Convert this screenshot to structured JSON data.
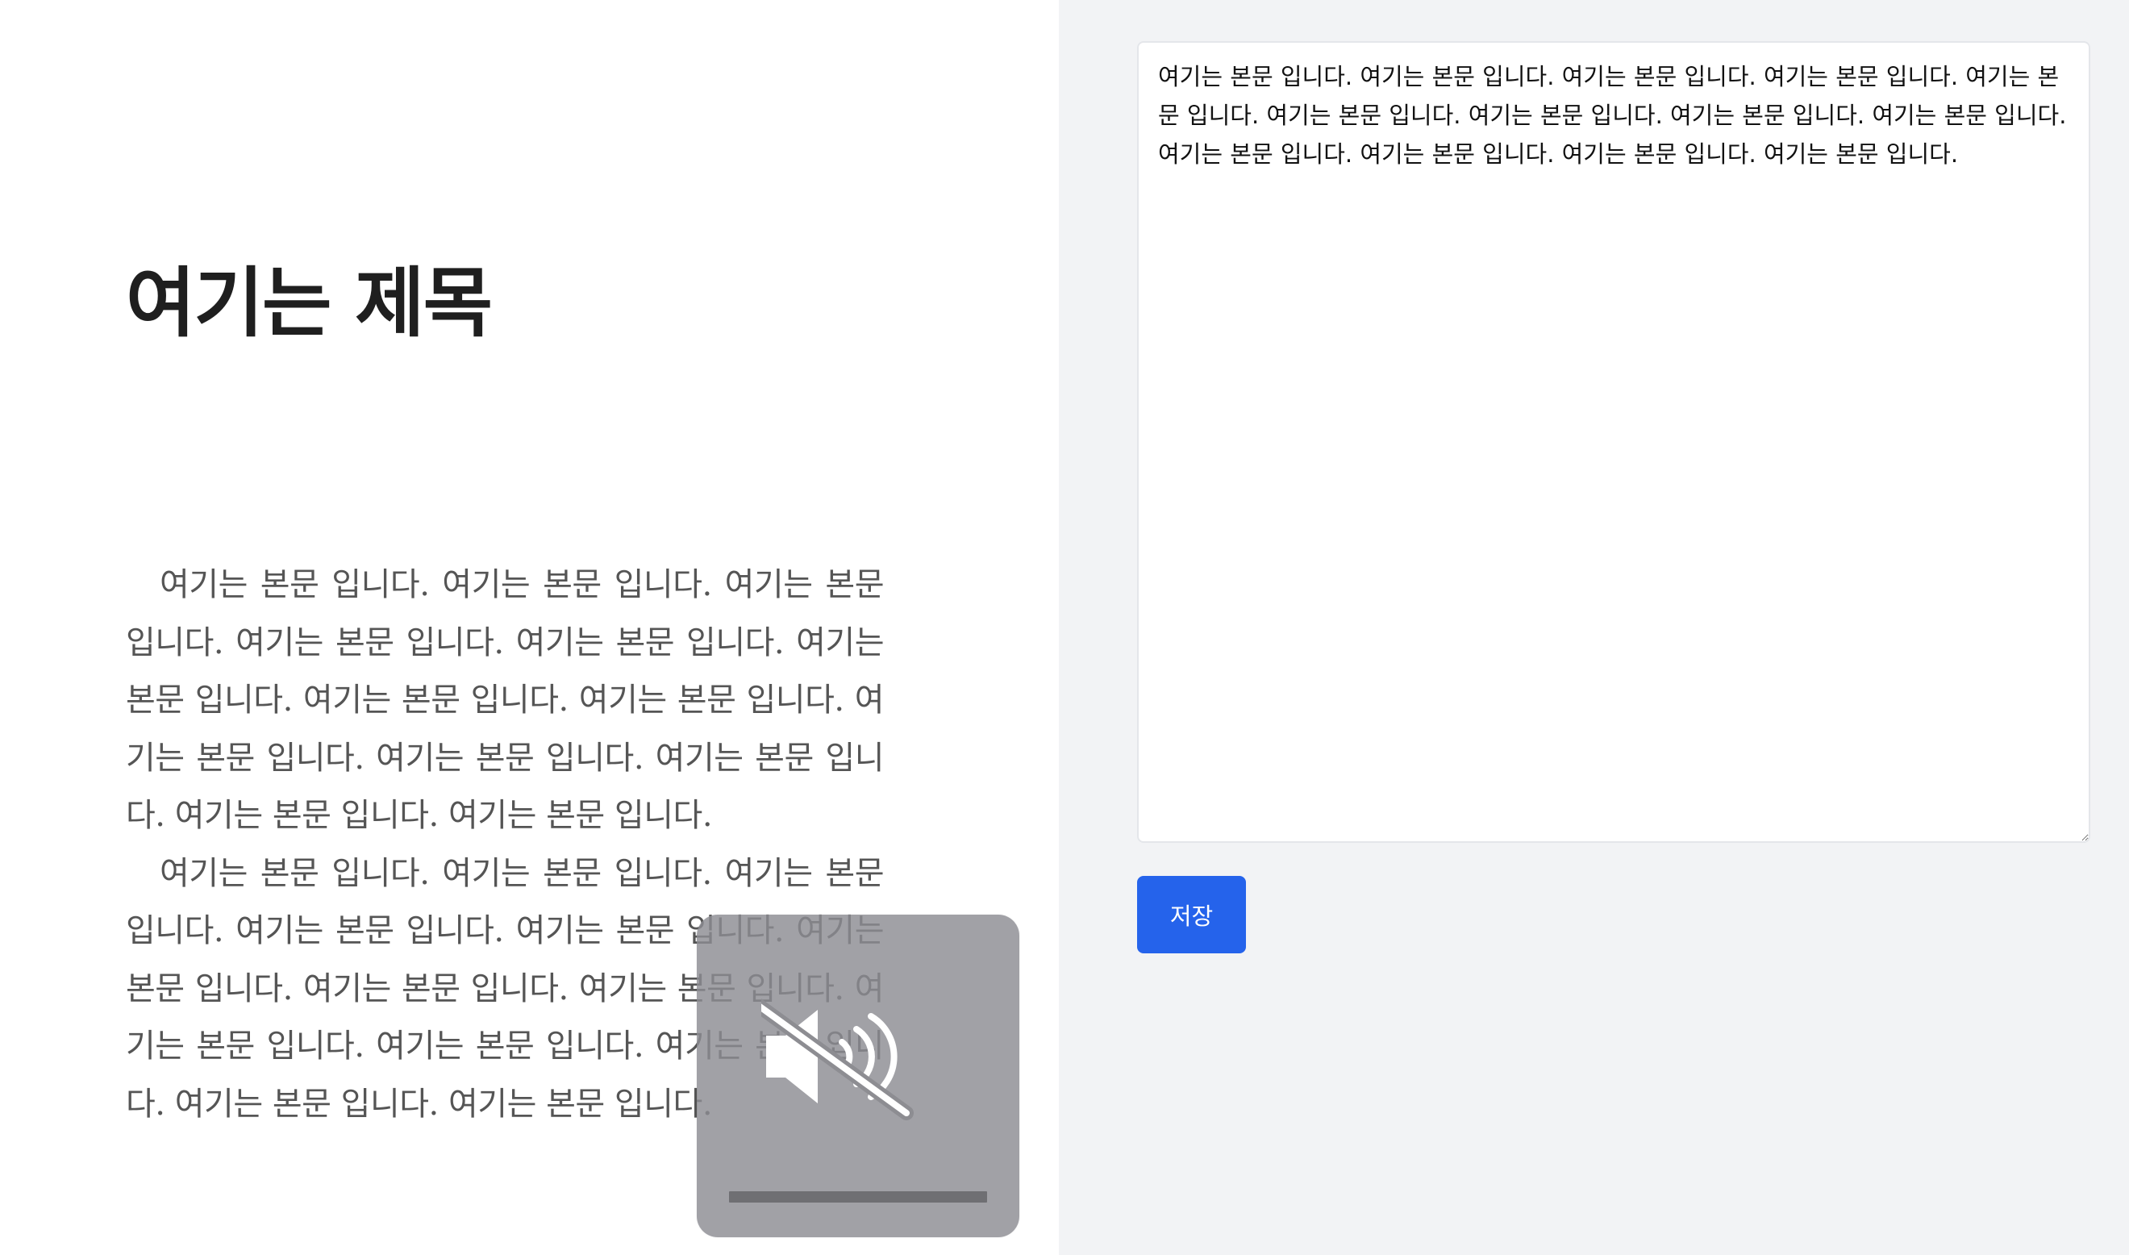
{
  "document": {
    "title": "여기는 제목",
    "paragraphs": [
      "여기는 본문 입니다. 여기는 본문 입니다. 여기는 본문 입니다. 여기는 본문 입니다. 여기는 본문 입니다. 여기는 본문 입니다. 여기는 본문 입니다. 여기는 본문 입니다. 여기는 본문 입니다. 여기는 본문 입니다. 여기는 본문 입니다. 여기는 본문 입니다. 여기는 본문 입니다.",
      "여기는 본문 입니다. 여기는 본문 입니다. 여기는 본문 입니다. 여기는 본문 입니다. 여기는 본문 입니다. 여기는 본문 입니다. 여기는 본문 입니다. 여기는 본문 입니다. 여기는 본문 입니다. 여기는 본문 입니다. 여기는 본문 입니다. 여기는 본문 입니다. 여기는 본문 입니다."
    ]
  },
  "editor": {
    "value": "여기는 본문 입니다. 여기는 본문 입니다. 여기는 본문 입니다. 여기는 본문 입니다. 여기는 본문 입니다. 여기는 본문 입니다. 여기는 본문 입니다. 여기는 본문 입니다. 여기는 본문 입니다. 여기는 본문 입니다. 여기는 본문 입니다. 여기는 본문 입니다. 여기는 본문 입니다."
  },
  "actions": {
    "save_label": "저장"
  },
  "volume_hud": {
    "icon": "speaker-muted-icon",
    "muted": true,
    "level": 0
  },
  "colors": {
    "accent": "#2563eb",
    "panel_background": "#f2f3f5"
  }
}
